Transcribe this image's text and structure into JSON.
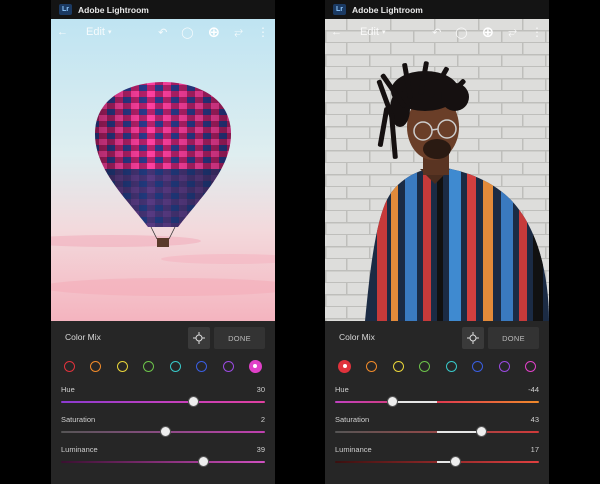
{
  "app": {
    "logo_text": "Lr",
    "title": "Adobe Lightroom"
  },
  "toolbar": {
    "edit_label": "Edit"
  },
  "panel": {
    "title": "Color Mix",
    "done_label": "DONE"
  },
  "colors": {
    "red": "#e0323c",
    "orange": "#f08a2a",
    "yellow": "#e8d43a",
    "green": "#6cc24a",
    "aqua": "#38c8c8",
    "blue": "#3a5ee0",
    "purple": "#9a4ae0",
    "magenta": "#e040c8"
  },
  "screens": [
    {
      "photo": "hot-air-balloon",
      "selected_color": "magenta",
      "sliders": [
        {
          "label": "Hue",
          "value": "30",
          "fraction": 0.65
        },
        {
          "label": "Saturation",
          "value": "2",
          "fraction": 0.51
        },
        {
          "label": "Luminance",
          "value": "39",
          "fraction": 0.7
        }
      ]
    },
    {
      "photo": "man-with-glasses",
      "selected_color": "red",
      "sliders": [
        {
          "label": "Hue",
          "value": "-44",
          "fraction": 0.28
        },
        {
          "label": "Saturation",
          "value": "43",
          "fraction": 0.72
        },
        {
          "label": "Luminance",
          "value": "17",
          "fraction": 0.59
        }
      ]
    }
  ]
}
